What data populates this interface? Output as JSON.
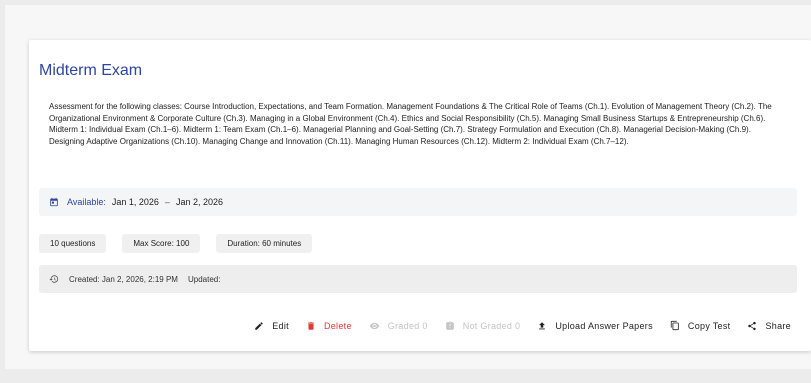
{
  "exam": {
    "title": "Midterm Exam",
    "description": "Assessment for the following classes: Course Introduction, Expectations, and Team Formation. Management Foundations & The Critical Role of Teams (Ch.1). Evolution of Management Theory (Ch.2). The Organizational Environment & Corporate Culture (Ch.3). Managing in a Global Environment (Ch.4). Ethics and Social Responsibility (Ch.5). Managing Small Business Startups & Entrepreneurship (Ch.6). Midterm 1: Individual Exam (Ch.1–6). Midterm 1: Team Exam (Ch.1–6). Managerial Planning and Goal-Setting (Ch.7). Strategy Formulation and Execution (Ch.8). Managerial Decision-Making (Ch.9). Designing Adaptive Organizations (Ch.10). Managing Change and Innovation (Ch.11). Managing Human Resources (Ch.12). Midterm 2: Individual Exam (Ch.7–12).",
    "availability": {
      "label": "Available:",
      "start": "Jan 1, 2026",
      "separator": "–",
      "end": "Jan 2, 2026"
    },
    "chips": {
      "questions": "10 questions",
      "max_score": "Max Score: 100",
      "duration": "Duration: 60 minutes"
    },
    "meta": {
      "created": "Created: Jan 2, 2026, 2:19 PM",
      "updated": "Updated:"
    }
  },
  "actions": {
    "edit": "Edit",
    "delete": "Delete",
    "graded": "Graded 0",
    "not_graded": "Not Graded 0",
    "upload": "Upload Answer Papers",
    "copy": "Copy Test",
    "share": "Share"
  },
  "colors": {
    "accent": "#2f45a6",
    "danger": "#e53935",
    "disabled": "#c4c4c4"
  },
  "icons": {
    "calendar": "calendar-icon",
    "history": "history-icon",
    "edit": "pencil-icon",
    "delete": "trash-icon",
    "graded": "eye-icon",
    "not_graded": "clipboard-icon",
    "upload": "upload-icon",
    "copy": "copy-icon",
    "share": "share-icon"
  }
}
